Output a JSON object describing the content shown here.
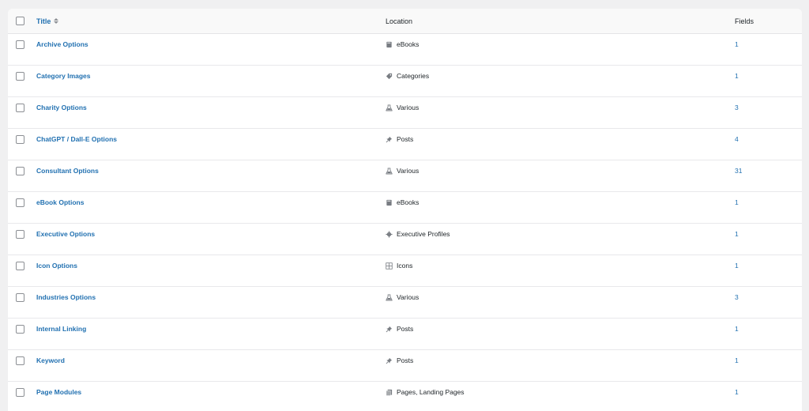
{
  "table": {
    "headers": {
      "title": "Title",
      "location": "Location",
      "fields": "Fields"
    },
    "rows": [
      {
        "title": "Archive Options",
        "location": "eBooks",
        "icon": "book-icon",
        "fields": "1"
      },
      {
        "title": "Category Images",
        "location": "Categories",
        "icon": "tag-icon",
        "fields": "1"
      },
      {
        "title": "Charity Options",
        "location": "Various",
        "icon": "flask-icon",
        "fields": "3"
      },
      {
        "title": "ChatGPT / Dall-E Options",
        "location": "Posts",
        "icon": "pin-icon",
        "fields": "4"
      },
      {
        "title": "Consultant Options",
        "location": "Various",
        "icon": "flask-icon",
        "fields": "31"
      },
      {
        "title": "eBook Options",
        "location": "eBooks",
        "icon": "book-icon",
        "fields": "1"
      },
      {
        "title": "Executive Options",
        "location": "Executive Profiles",
        "icon": "gear-icon",
        "fields": "1"
      },
      {
        "title": "Icon Options",
        "location": "Icons",
        "icon": "grid-icon",
        "fields": "1"
      },
      {
        "title": "Industries Options",
        "location": "Various",
        "icon": "flask-icon",
        "fields": "3"
      },
      {
        "title": "Internal Linking",
        "location": "Posts",
        "icon": "pin-icon",
        "fields": "1"
      },
      {
        "title": "Keyword",
        "location": "Posts",
        "icon": "pin-icon",
        "fields": "1"
      },
      {
        "title": "Page Modules",
        "location": "Pages, Landing Pages",
        "icon": "pages-icon",
        "fields": "1"
      }
    ]
  },
  "colors": {
    "link": "#2271b1",
    "text": "#1d2327",
    "icon": "#787c82"
  }
}
